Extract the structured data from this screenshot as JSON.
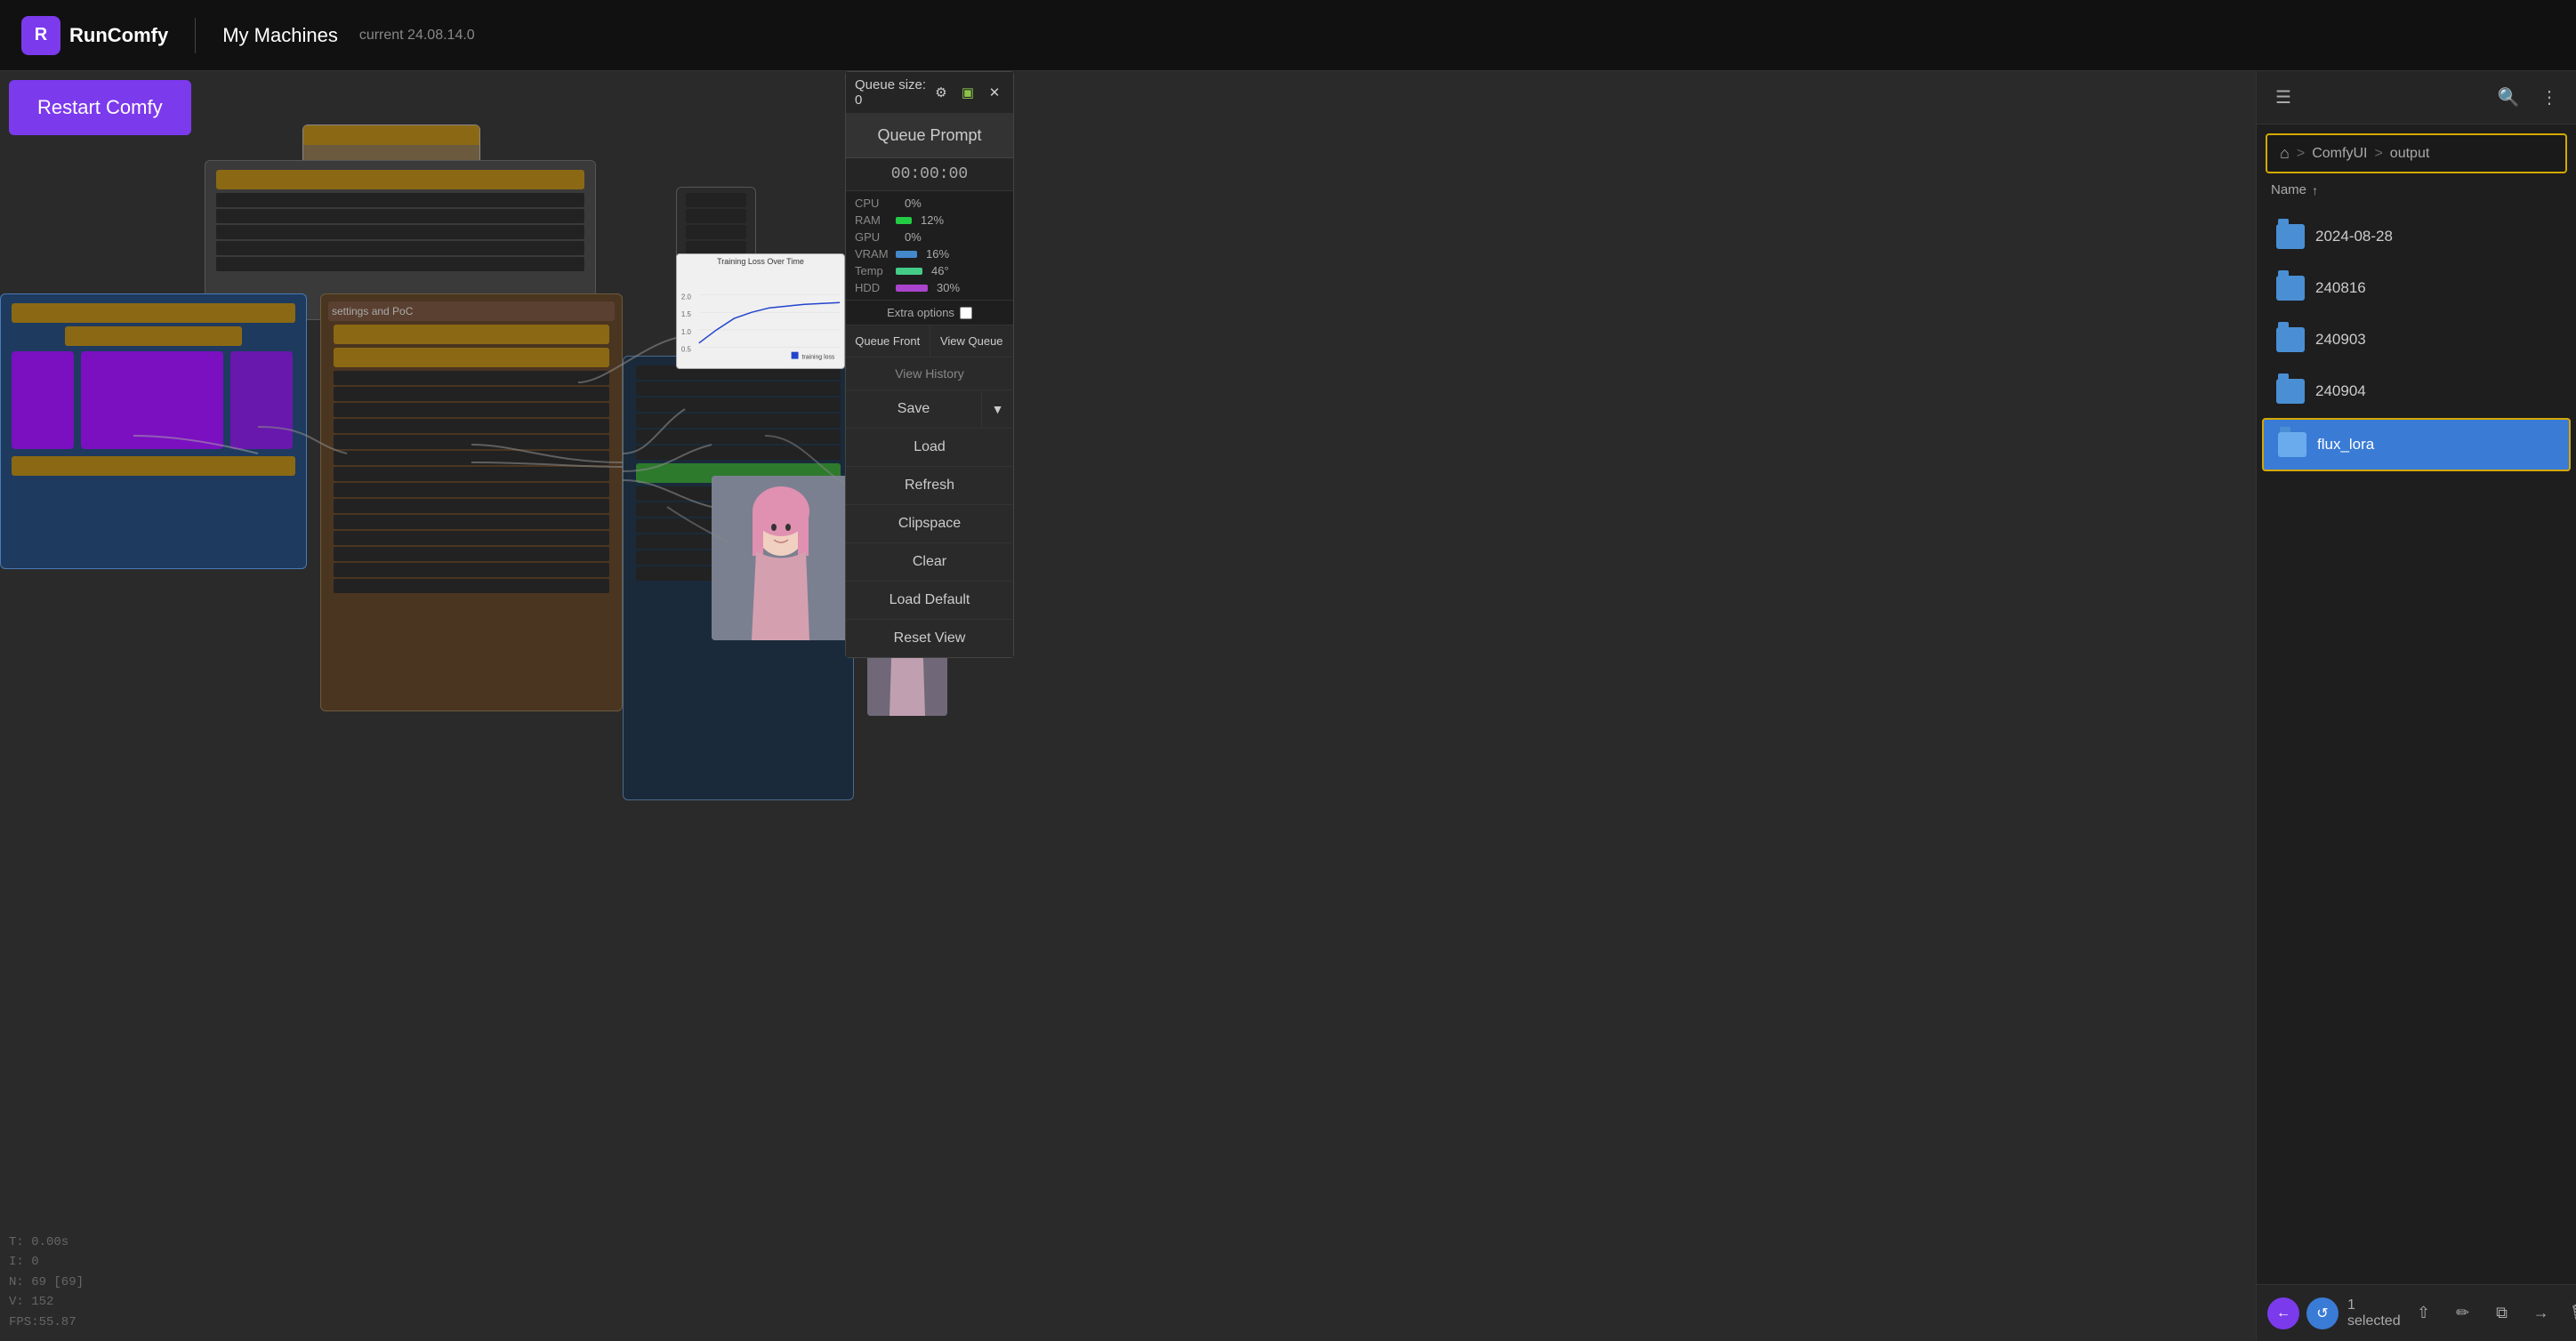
{
  "app": {
    "logo_letter": "R",
    "logo_name": "RunComfy",
    "divider": "|",
    "machine_label": "My Machines",
    "version": "current 24.08.14.0"
  },
  "toolbar": {
    "restart_label": "Restart Comfy"
  },
  "queue": {
    "title": "Queue size: 0",
    "prompt_btn": "Queue Prompt",
    "timer": "00:00:00",
    "stats": {
      "cpu_label": "CPU",
      "cpu_val": "0%",
      "cpu_color": "#cc4444",
      "ram_label": "RAM",
      "ram_val": "12%",
      "ram_color": "#22cc44",
      "gpu_label": "GPU",
      "gpu_val": "0%",
      "gpu_color": "#cc4444",
      "vram_label": "VRAM",
      "vram_val": "16%",
      "vram_color": "#4488cc",
      "temp_label": "Temp",
      "temp_val": "46°",
      "temp_color": "#44cc88",
      "hdd_label": "HDD",
      "hdd_val": "30%",
      "hdd_color": "#aa44cc"
    },
    "extra_options": "Extra options",
    "buttons": {
      "queue_front": "Queue Front",
      "view_queue": "View Queue",
      "view_history": "View History",
      "save": "Save",
      "load": "Load",
      "refresh": "Refresh",
      "clipspace": "Clipspace",
      "clear": "Clear",
      "load_default": "Load Default",
      "reset_view": "Reset View"
    }
  },
  "file_browser": {
    "breadcrumb": {
      "home": "⌂",
      "sep1": ">",
      "path1": "ComfyUI",
      "sep2": ">",
      "path2": "output"
    },
    "column_name": "Name",
    "sort_arrow": "↑",
    "folders": [
      {
        "name": "2024-08-28"
      },
      {
        "name": "240816"
      },
      {
        "name": "240903"
      },
      {
        "name": "240904"
      },
      {
        "name": "flux_lora",
        "selected": true
      }
    ],
    "selected_count": "1 selected",
    "bottom_icons": [
      "←",
      "↺",
      "⇧",
      "✏",
      "⧉",
      "→",
      "🗑"
    ]
  },
  "canvas": {
    "corner_info": {
      "t": "T: 0.00s",
      "i": "I: 0",
      "n": "N: 69 [69]",
      "v": "V: 152",
      "fps": "FPS:55.87"
    }
  }
}
